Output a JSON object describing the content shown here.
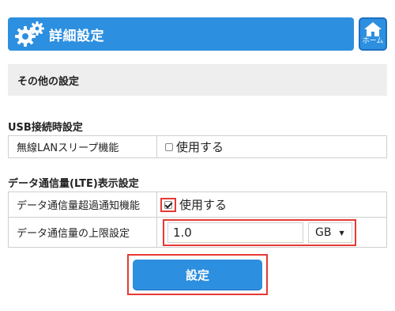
{
  "header": {
    "title": "詳細設定",
    "home_label": "ホーム",
    "accent": "#2d8fe0"
  },
  "section": {
    "title": "その他の設定"
  },
  "usb_group": {
    "title": "USB接続時設定",
    "rows": [
      {
        "label": "無線LANスリープ機能",
        "checkbox_label": "使用する",
        "checked": false
      }
    ]
  },
  "lte_group": {
    "title": "データ通信量(LTE)表示設定",
    "notify_row": {
      "label": "データ通信量超過通知機能",
      "checkbox_label": "使用する",
      "checked": true
    },
    "limit_row": {
      "label": "データ通信量の上限設定",
      "value": "1.0",
      "unit": "GB"
    }
  },
  "submit": {
    "label": "設定"
  },
  "highlight_color": "#e53935"
}
